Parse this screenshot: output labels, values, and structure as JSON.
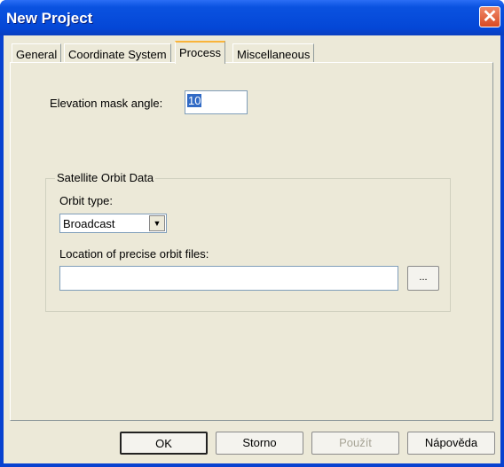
{
  "window": {
    "title": "New Project",
    "close_icon": "close-icon"
  },
  "tabs": [
    {
      "label": "General"
    },
    {
      "label": "Coordinate System"
    },
    {
      "label": "Process",
      "active": true
    },
    {
      "label": "Miscellaneous"
    }
  ],
  "process": {
    "elevation_label": "Elevation mask angle:",
    "elevation_value": "10",
    "group_title": "Satellite Orbit Data",
    "orbit_type_label": "Orbit type:",
    "orbit_type_value": "Broadcast",
    "location_label": "Location of precise orbit files:",
    "location_value": "",
    "browse_label": "..."
  },
  "buttons": {
    "ok": "OK",
    "cancel": "Storno",
    "apply": "Použít",
    "help": "Nápověda"
  }
}
